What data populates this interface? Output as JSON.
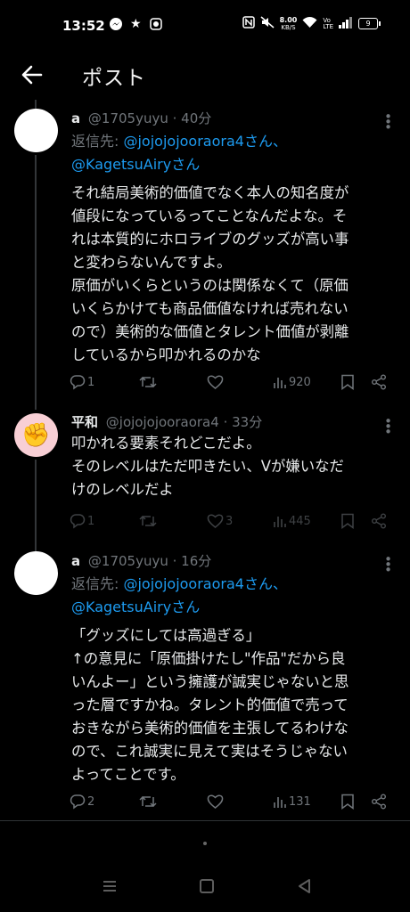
{
  "status_bar": {
    "time": "13:52",
    "net_speed_value": "8.00",
    "net_speed_unit": "KB/S",
    "battery": "9"
  },
  "header": {
    "title": "ポスト"
  },
  "tweets": [
    {
      "name": "a",
      "handle": "@1705yuyu",
      "time": "· 40分",
      "reply_label": "返信先: ",
      "reply_mention_1": "@jojojojooraora4さん、",
      "reply_mention_2": "@KagetsuAiryさん",
      "text": "それ結局美術的価値でなく本人の知名度が\n値段になっているってことなんだよな。そ\nれは本質的にホロライブのグッズが高い事\nと変わらないんですよ。\n原価がいくらというのは関係なくて（原価\nいくらかけても商品価値なければ売れない\nので）美術的な価値とタレント価値が剥離\nしているから叩かれるのかな",
      "replies": "1",
      "retweets": "",
      "likes": "",
      "views": "920"
    },
    {
      "name": "平和",
      "handle": "@jojojojooraora4",
      "time": "· 33分",
      "avatar_emoji": "✊",
      "text": "叩かれる要素それどこだよ。\nそのレベルはただ叩きたい、Vが嫌いなだ\nけのレベルだよ",
      "replies": "1",
      "retweets": "",
      "likes": "3",
      "views": "445"
    },
    {
      "name": "a",
      "handle": "@1705yuyu",
      "time": "· 16分",
      "reply_label": "返信先: ",
      "reply_mention_1": "@jojojojooraora4さん、",
      "reply_mention_2": "@KagetsuAiryさん",
      "text": "「グッズにしては高過ぎる」\n↑の意見に「原価掛けたし\"作品\"だから良\nいんよー」という擁護が誠実じゃないと思\nった層ですかね。タレント的価値で売って\nおきながら美術的価値を主張してるわけな\nので、これ誠実に見えて実はそうじゃない\nよってことです。",
      "replies": "2",
      "retweets": "",
      "likes": "",
      "views": "131"
    }
  ],
  "colors": {
    "accent": "#1d9bf0",
    "muted": "#71767b",
    "background": "#000000"
  }
}
